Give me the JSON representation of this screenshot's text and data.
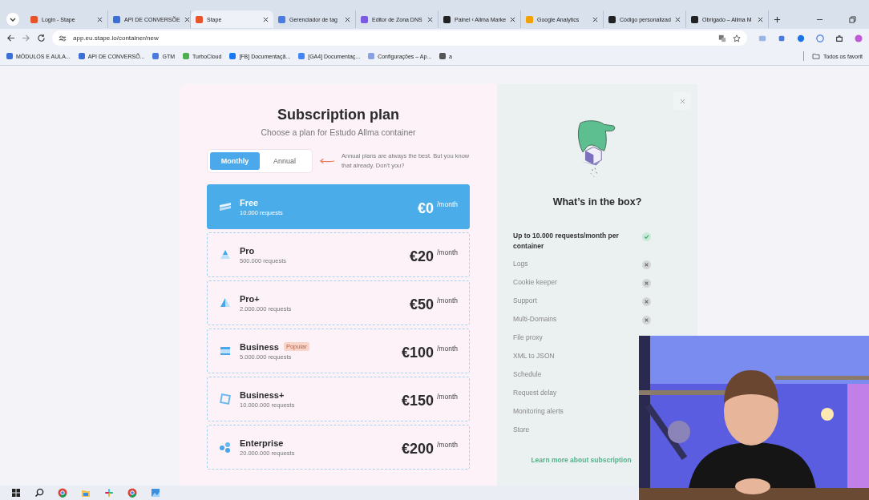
{
  "tabs": [
    {
      "title": "Login - Stape",
      "selected": false
    },
    {
      "title": "API DE CONVERSÕE",
      "selected": false
    },
    {
      "title": "Stape",
      "selected": true
    },
    {
      "title": "Gerenciador de tag",
      "selected": false
    },
    {
      "title": "Editor de Zona DNS",
      "selected": false
    },
    {
      "title": "Painel ‹ Allma Marke",
      "selected": false
    },
    {
      "title": "Google Analytics",
      "selected": false
    },
    {
      "title": "Código personalizad",
      "selected": false
    },
    {
      "title": "Obrigado – Allma M",
      "selected": false
    }
  ],
  "address": "app.eu.stape.io/container/new",
  "bookmarks": [
    "MÓDULOS E AULA...",
    "API DE CONVERSÕ...",
    "GTM",
    "TurboCloud",
    "[FB] Documentaçã...",
    "[GA4] Documentaç...",
    "Configurações – Ap...",
    "a"
  ],
  "bookmarks_folder": "Todos os favorit",
  "plan": {
    "title": "Subscription plan",
    "subtitle": "Choose a plan for Estudo Allma container",
    "billing": [
      {
        "label": "Monthly",
        "selected": true
      },
      {
        "label": "Annual",
        "selected": false
      }
    ],
    "note": "Annual plans are always the best. But you know that already. Don't you?",
    "plans": [
      {
        "name": "Free",
        "requests": "10.000 requests",
        "price": "€0",
        "period": "/month",
        "selected": true
      },
      {
        "name": "Pro",
        "requests": "500.000 requests",
        "price": "€20",
        "period": "/month",
        "selected": false
      },
      {
        "name": "Pro+",
        "requests": "2.000.000 requests",
        "price": "€50",
        "period": "/month",
        "selected": false
      },
      {
        "name": "Business",
        "badge": "Popular",
        "requests": "5.000.000 requests",
        "price": "€100",
        "period": "/month",
        "selected": false
      },
      {
        "name": "Business+",
        "requests": "10.000.000 requests",
        "price": "€150",
        "period": "/month",
        "selected": false
      },
      {
        "name": "Enterprise",
        "requests": "20.000.000 requests",
        "price": "€200",
        "period": "/month",
        "selected": false
      }
    ]
  },
  "box": {
    "title": "What’s in the box?",
    "features": [
      {
        "text": "Up to 10.000 requests/month per container",
        "included": true
      },
      {
        "text": "Logs",
        "included": false
      },
      {
        "text": "Cookie keeper",
        "included": false
      },
      {
        "text": "Support",
        "included": false
      },
      {
        "text": "Multi-Domains",
        "included": false
      },
      {
        "text": "File proxy"
      },
      {
        "text": "XML to JSON"
      },
      {
        "text": "Schedule"
      },
      {
        "text": "Request delay"
      },
      {
        "text": "Monitoring alerts"
      },
      {
        "text": "Store"
      }
    ],
    "link": "Learn more about subscription"
  },
  "webcam": {
    "kind": "picture"
  }
}
